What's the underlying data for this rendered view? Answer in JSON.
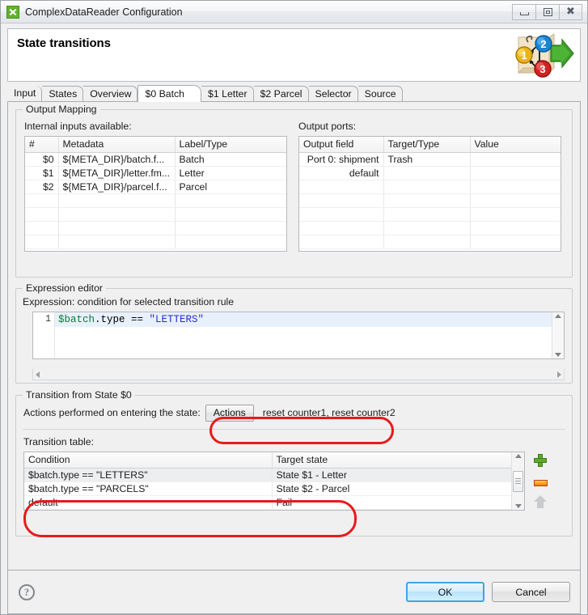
{
  "window": {
    "title": "ComplexDataReader Configuration",
    "app_icon": "complex-data-reader-icon",
    "minimize_label": "",
    "maximize_label": "",
    "close_label": "✕"
  },
  "header": {
    "title": "State transitions",
    "icon": "state-transitions-diagram-icon",
    "icon_nodes": [
      "1",
      "2",
      "3"
    ],
    "colors": {
      "node1": "#e8b417",
      "node2": "#1a86d6",
      "node3": "#d32222",
      "arrow": "#3fa02a"
    }
  },
  "tabs": [
    {
      "label": "Input",
      "selected": false
    },
    {
      "label": "States",
      "selected": false
    },
    {
      "label": "Overview",
      "selected": false
    },
    {
      "label": "$0 Batch",
      "selected": true
    },
    {
      "label": "$1 Letter",
      "selected": false
    },
    {
      "label": "$2 Parcel",
      "selected": false
    },
    {
      "label": "Selector",
      "selected": false
    },
    {
      "label": "Source",
      "selected": false
    }
  ],
  "output_mapping": {
    "group_label": "Output Mapping",
    "internal_inputs": {
      "caption": "Internal inputs available:",
      "columns": [
        "#",
        "Metadata",
        "Label/Type"
      ],
      "rows": [
        {
          "num": "$0",
          "metadata": "${META_DIR}/batch.f...",
          "label": "Batch"
        },
        {
          "num": "$1",
          "metadata": "${META_DIR}/letter.fm...",
          "label": "Letter"
        },
        {
          "num": "$2",
          "metadata": "${META_DIR}/parcel.f...",
          "label": "Parcel"
        }
      ],
      "empty_rows": 4
    },
    "output_ports": {
      "caption": "Output ports:",
      "columns": [
        "Output field",
        "Target/Type",
        "Value"
      ],
      "rows": [
        {
          "field": "Port 0: shipment",
          "target": "Trash",
          "value": ""
        },
        {
          "field": "default",
          "target": "",
          "value": ""
        }
      ],
      "empty_rows": 5
    }
  },
  "expression_editor": {
    "group_label": "Expression editor",
    "caption": "Expression: condition for selected transition rule",
    "line_number": "1",
    "code_tokens": [
      {
        "text": "$batch",
        "kind": "variable",
        "color": "#0a7a32"
      },
      {
        "text": ".type == ",
        "kind": "plain",
        "color": "#000000"
      },
      {
        "text": "\"LETTERS\"",
        "kind": "string",
        "color": "#2a2ad2"
      }
    ],
    "code_plain": "$batch.type == \"LETTERS\""
  },
  "transition": {
    "group_label": "Transition from State $0",
    "actions_caption": "Actions performed on entering the state:",
    "actions_button": "Actions",
    "actions_value": "reset counter1, reset counter2",
    "table_label": "Transition table:",
    "columns": [
      "Condition",
      "Target state"
    ],
    "rows": [
      {
        "condition": "$batch.type == \"LETTERS\"",
        "target": "State $1 - Letter",
        "selected": true,
        "muted": false
      },
      {
        "condition": "$batch.type == \"PARCELS\"",
        "target": "State $2 - Parcel",
        "selected": false,
        "muted": false
      },
      {
        "condition": "default",
        "target": "Fail",
        "selected": false,
        "muted": true
      }
    ],
    "side_buttons": [
      {
        "name": "add-row-button",
        "icon": "plus-icon"
      },
      {
        "name": "remove-row-button",
        "icon": "minus-icon"
      },
      {
        "name": "move-up-button",
        "icon": "up-arrow-icon"
      }
    ]
  },
  "footer": {
    "help_label": "?",
    "ok_label": "OK",
    "cancel_label": "Cancel"
  },
  "annotations": {
    "color": "#e81a1a",
    "items": [
      "actions-row-highlight",
      "transition-rows-highlight"
    ]
  }
}
